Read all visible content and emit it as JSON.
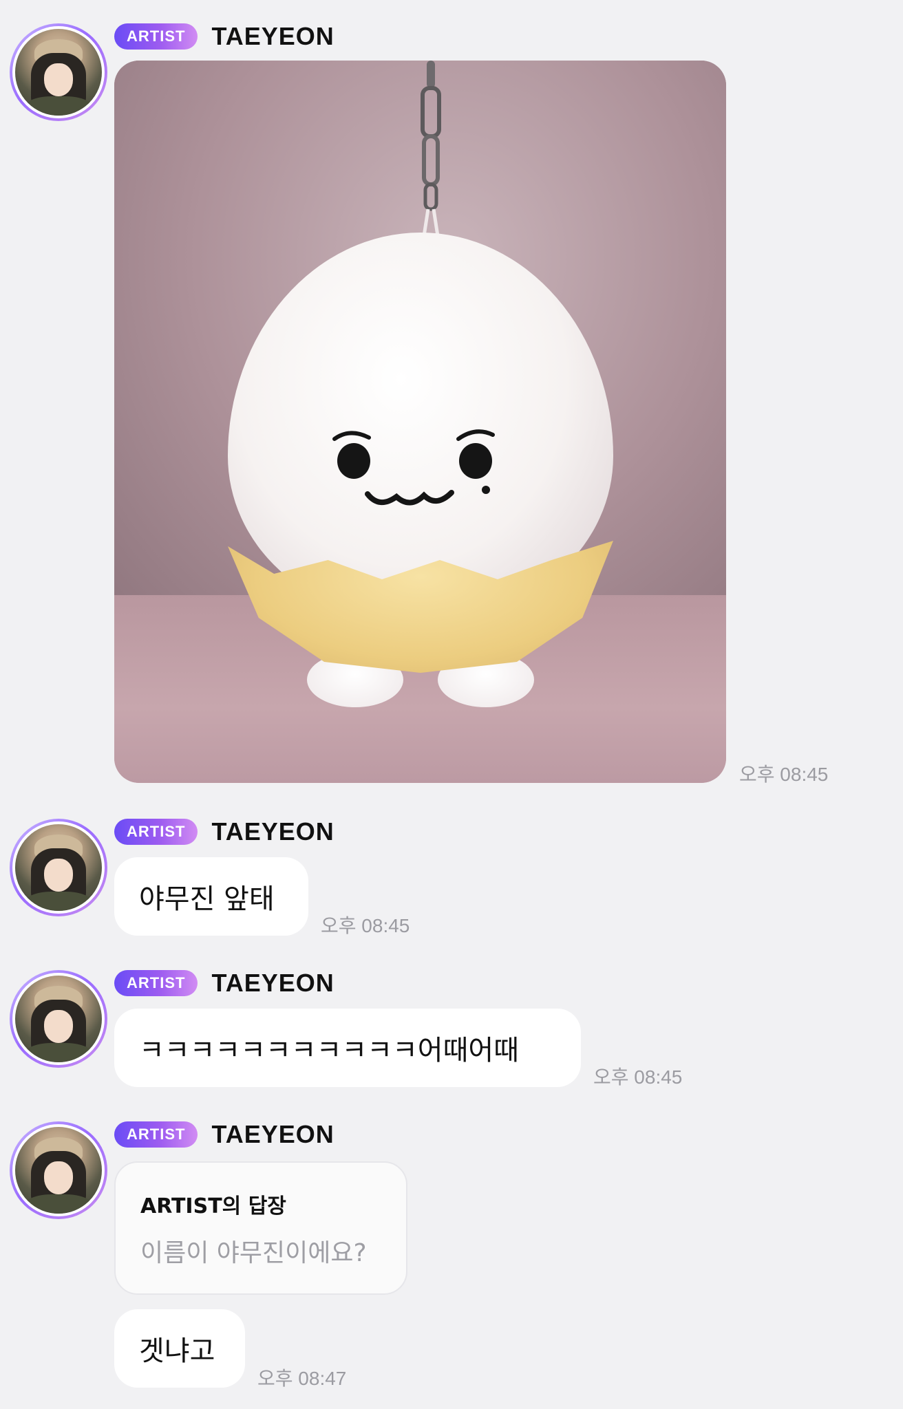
{
  "messages": [
    {
      "badge": "ARTIST",
      "sender": "TAEYEON",
      "type": "image",
      "time": "오후 08:45"
    },
    {
      "badge": "ARTIST",
      "sender": "TAEYEON",
      "type": "text",
      "text": "야무진 앞태",
      "time": "오후 08:45"
    },
    {
      "badge": "ARTIST",
      "sender": "TAEYEON",
      "type": "text",
      "text": "ㅋㅋㅋㅋㅋㅋㅋㅋㅋㅋㅋ어때어때",
      "time": "오후 08:45"
    },
    {
      "badge": "ARTIST",
      "sender": "TAEYEON",
      "type": "reply",
      "reply_title": "ARTIST의 답장",
      "reply_quote": "이름이 야무진이에요?",
      "text": "겟냐고",
      "time": "오후 08:47"
    }
  ],
  "colors": {
    "background": "#f1f1f3",
    "bubble": "#ffffff",
    "badge_start": "#6a4cf5",
    "badge_end": "#d18cf3",
    "timestamp": "#9b9ba1",
    "reply_quote": "#9e9ea4"
  }
}
